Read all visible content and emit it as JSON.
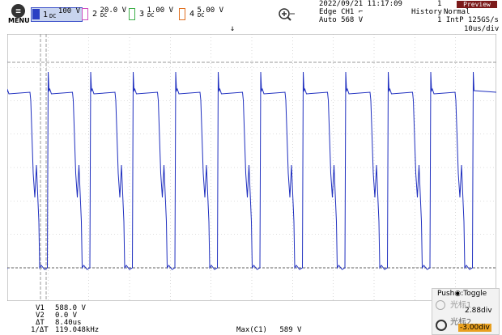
{
  "menu": {
    "icon": "menu-icon",
    "label": "MENU"
  },
  "channels": [
    {
      "num": "1",
      "value": "100 V",
      "coupling": "DC",
      "color": "#2a3fc4"
    },
    {
      "num": "2",
      "value": "20.0 V",
      "coupling": "DC",
      "color": "#d04fc0"
    },
    {
      "num": "3",
      "value": "1.00 V",
      "coupling": "DC",
      "color": "#3fb04a"
    },
    {
      "num": "4",
      "value": "5.00 V",
      "coupling": "DC",
      "color": "#e07020"
    }
  ],
  "zoom_icon": "zoom-in-icon",
  "datetime": "2022/09/21 11:17:09",
  "trigger": {
    "line1": "Edge CH1",
    "slope_icon": "rising-edge-icon",
    "line2": "Auto 568 V"
  },
  "acquisition": {
    "history": "History",
    "count": "1",
    "mode": "Normal",
    "interp": "1 IntP",
    "rate": "125GS/s"
  },
  "preview_label": "Preview",
  "timebase": "10us/div",
  "trace_color": "#1f2fbf",
  "measurements": [
    {
      "label": "V1",
      "value": "588.0 V"
    },
    {
      "label": "V2",
      "value": "0.0 V"
    },
    {
      "label": "ΔT",
      "value": "8.40us"
    },
    {
      "label": "1/ΔT",
      "value": "119.048kHz"
    }
  ],
  "max_readout": {
    "label": "Max(C1)",
    "value": "589 V"
  },
  "cursor_panel": {
    "push": "Push",
    "toggle": ":Toggle",
    "cursor1_label": "光标1",
    "cursor1_value": "2.88div",
    "cursor2_label": "光标2",
    "cursor2_value": "-3.00div"
  }
}
